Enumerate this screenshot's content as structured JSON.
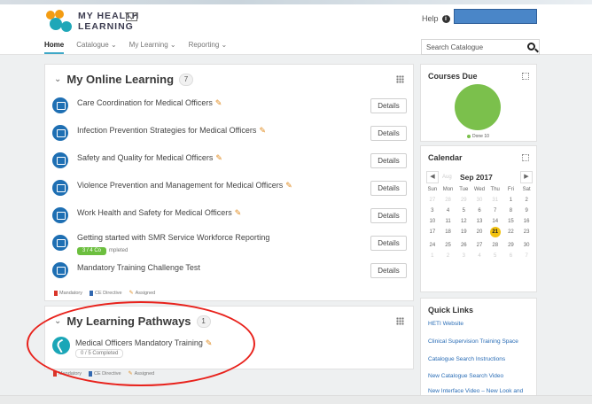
{
  "app": {
    "logo_line1": "MY HEALTH",
    "logo_line2": "LEARNING",
    "help_label": "Help"
  },
  "nav": {
    "items": [
      "Home",
      "Catalogue",
      "My Learning",
      "Reporting"
    ],
    "active": "Home"
  },
  "search": {
    "placeholder": "Search Catalogue"
  },
  "online_learning": {
    "title": "My Online Learning",
    "count": "7",
    "details_label": "Details",
    "courses": [
      {
        "title": "Care Coordination for Medical Officers"
      },
      {
        "title": "Infection Prevention Strategies for Medical Officers"
      },
      {
        "title": "Safety and Quality for Medical Officers"
      },
      {
        "title": "Violence Prevention and Management for Medical Officers"
      },
      {
        "title": "Work Health and Safety for Medical Officers"
      },
      {
        "title": "Getting started with SMR Service Workforce Reporting",
        "progress_badge": "3 / 4 Co",
        "progress_rest": "mpleted"
      },
      {
        "title": "Mandatory Training Challenge Test"
      }
    ],
    "legend": {
      "mandatory": "Mandatory",
      "ce_directive": "CE Directive",
      "assigned": "Assigned"
    }
  },
  "learning_pathways": {
    "title": "My Learning Pathways",
    "count": "1",
    "pathway_title": "Medical Officers Mandatory Training",
    "pathway_progress": "0 / 5 Completed",
    "legend": {
      "mandatory": "Mandatory",
      "ce_directive": "CE Directive",
      "assigned": "Assigned"
    }
  },
  "courses_due": {
    "title": "Courses Due",
    "legend_label": "Done 10",
    "legend_color": "#7bc04c"
  },
  "calendar": {
    "title": "Calendar",
    "month": "Sep 2017",
    "prev_month": "Aug",
    "day_headers": [
      "Sun",
      "Mon",
      "Tue",
      "Wed",
      "Thu",
      "Fri",
      "Sat"
    ],
    "weeks": [
      [
        "27",
        "28",
        "29",
        "30",
        "31",
        "1",
        "2"
      ],
      [
        "3",
        "4",
        "5",
        "6",
        "7",
        "8",
        "9"
      ],
      [
        "10",
        "11",
        "12",
        "13",
        "14",
        "15",
        "16"
      ],
      [
        "17",
        "18",
        "19",
        "20",
        "21",
        "22",
        "23"
      ],
      [
        "24",
        "25",
        "26",
        "27",
        "28",
        "29",
        "30"
      ],
      [
        "1",
        "2",
        "3",
        "4",
        "5",
        "6",
        "7"
      ]
    ],
    "today": "21",
    "highlight_color": "#f3c20e"
  },
  "quick_links": {
    "title": "Quick Links",
    "links": [
      "HETI Website",
      "Clinical Supervision Training Space",
      "Catalogue Search Instructions",
      "New Catalogue Search Video",
      "New Interface Video – New Look and Feel!"
    ]
  }
}
